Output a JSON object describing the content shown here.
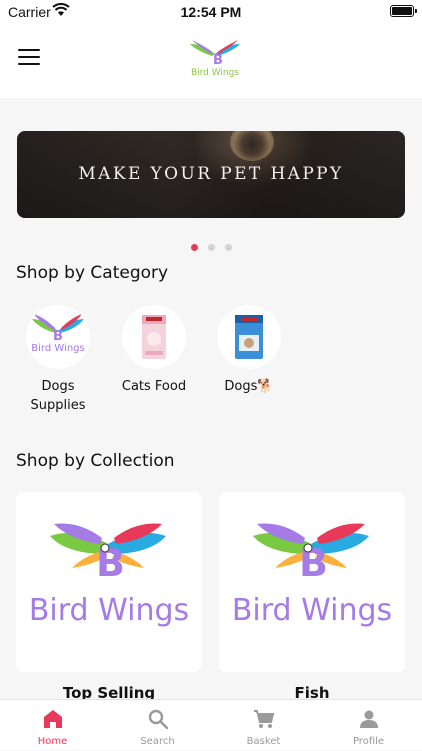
{
  "status": {
    "carrier": "Carrier",
    "time": "12:54 PM"
  },
  "header": {
    "logo_text": "Bird Wings"
  },
  "banner": {
    "caption": "MAKE YOUR PET HAPPY",
    "pages": 3,
    "active_page": 1
  },
  "categories": {
    "title": "Shop by Category",
    "items": [
      {
        "label": "Dogs Supplies",
        "icon": "bird-wings-logo"
      },
      {
        "label": "Cats Food",
        "icon": "cat-food-bag"
      },
      {
        "label": "Dogs🐕",
        "icon": "dog-food-bag"
      }
    ]
  },
  "collections": {
    "title": "Shop by Collection",
    "items": [
      {
        "label": "Top Selling",
        "logo_text": "Bird Wings"
      },
      {
        "label": "Fish",
        "logo_text": "Bird Wings"
      }
    ]
  },
  "tabs": [
    {
      "label": "Home",
      "icon": "home-icon",
      "active": true
    },
    {
      "label": "Search",
      "icon": "search-icon",
      "active": false
    },
    {
      "label": "Basket",
      "icon": "basket-icon",
      "active": false
    },
    {
      "label": "Profile",
      "icon": "profile-icon",
      "active": false
    }
  ],
  "colors": {
    "accent": "#e8395a",
    "background": "#f6f6f6",
    "logo_purple": "#a57be6"
  }
}
